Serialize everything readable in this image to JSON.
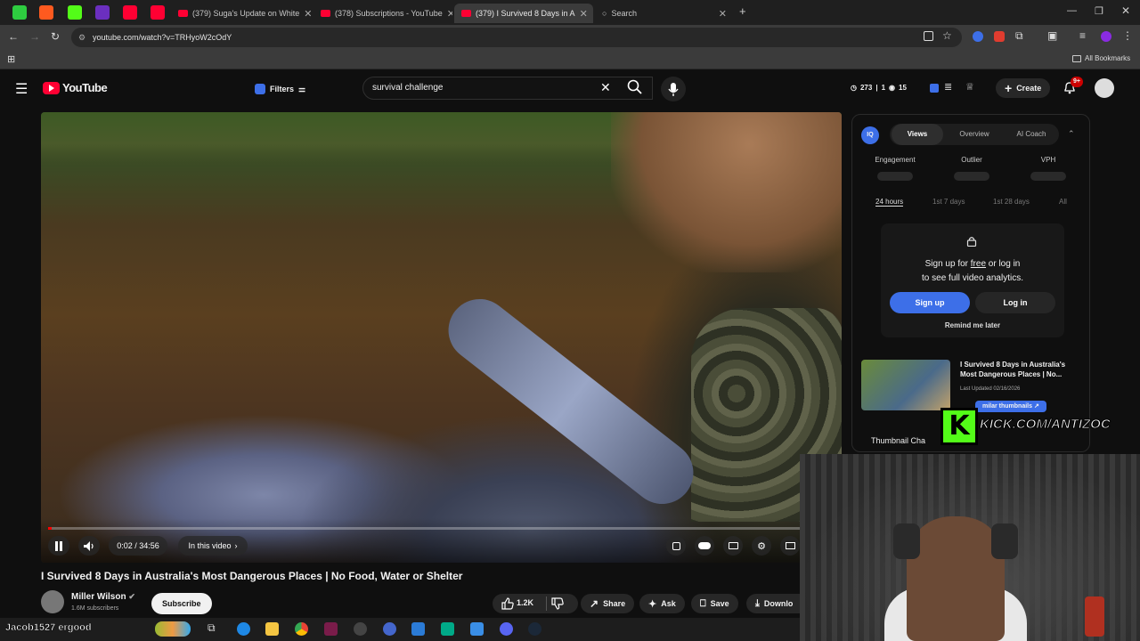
{
  "browser": {
    "tabs": [
      {
        "label": "(379) Suga's Update on White"
      },
      {
        "label": "(378) Subscriptions - YouTube"
      },
      {
        "label": "(379) I Survived 8 Days in A"
      },
      {
        "label": "Search"
      }
    ],
    "url": "youtube.com/watch?v=TRHyoW2cOdY",
    "all_bookmarks": "All Bookmarks"
  },
  "youtube": {
    "logo": "YouTube",
    "filters_label": "Filters",
    "search_value": "survival challenge",
    "stats": {
      "views": "273",
      "likes": "1",
      "watching": "15"
    },
    "create_label": "Create",
    "notif_badge": "9+"
  },
  "player": {
    "time": "0:02 / 34:56",
    "in_this_video": "In this video",
    "progress": 0.001
  },
  "video": {
    "title": "I Survived 8 Days in Australia's Most Dangerous Places | No Food, Water or Shelter",
    "channel": "Miller Wilson",
    "subscribers": "1.6M subscribers",
    "subscribe_label": "Subscribe",
    "likes": "1.2K",
    "share_label": "Share",
    "ask_label": "Ask",
    "save_label": "Save",
    "download_label": "Downlo"
  },
  "panel": {
    "logo": "IQ",
    "tabs": [
      "Views",
      "Overview",
      "AI Coach"
    ],
    "metrics": [
      "Engagement",
      "Outlier",
      "VPH"
    ],
    "ranges": [
      "24 hours",
      "1st 7 days",
      "1st 28 days",
      "All"
    ],
    "signup_line1_a": "Sign up for ",
    "signup_free": "free",
    "signup_line1_b": " or log in",
    "signup_line2": "to see full video analytics.",
    "signup_btn": "Sign up",
    "login_btn": "Log in",
    "remind": "Remind me later",
    "card_title": "I Survived 8 Days in Australia's Most Dangerous Places | No...",
    "card_updated": "Last Updated 02/16/2026",
    "card_similar": "milar thumbnails",
    "thumb_chat": "Thumbnail Cha"
  },
  "overlay": {
    "kick": "KICK.COM/ANTIZOC",
    "username": "Jacob1527 ",
    "username2": "ergood"
  },
  "colors": {
    "accent": "#3d6fe8",
    "yt_red": "#ff0033",
    "kick_green": "#53fc18"
  }
}
